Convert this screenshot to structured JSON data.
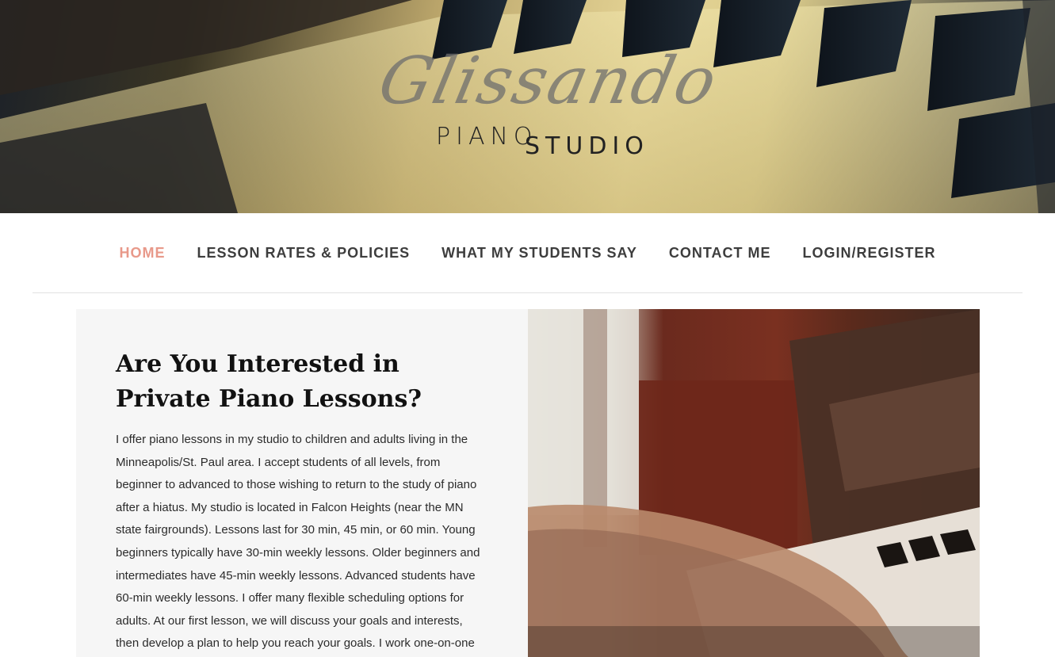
{
  "brand": {
    "script": "Glissando",
    "word1": "PIANO",
    "word2": "STUDIO"
  },
  "nav": {
    "items": [
      {
        "label": "HOME",
        "active": true
      },
      {
        "label": "LESSON RATES & POLICIES",
        "active": false
      },
      {
        "label": "WHAT MY STUDENTS SAY",
        "active": false
      },
      {
        "label": "CONTACT ME",
        "active": false
      },
      {
        "label": "LOGIN/REGISTER",
        "active": false
      }
    ],
    "active_color": "#e8998a"
  },
  "main": {
    "heading": "Are You Interested in Private Piano Lessons?",
    "body": "I offer piano lessons in my studio to children and adults living in the Minneapolis/St. Paul area. I accept students of all levels, from beginner to advanced to those wishing to return to the study of piano after a hiatus. My studio is located in Falcon Heights (near the MN state fairgrounds). Lessons last for 30 min, 45 min, or 60 min. Young beginners typically have 30-min weekly lessons. Older beginners and intermediates have 45-min weekly lessons. Advanced students have 60-min weekly lessons. I offer many flexible scheduling options for adults. At our first lesson, we will discuss your goals and interests, then develop a plan to help you reach your goals. I work one-on-one"
  },
  "images": {
    "hero": "piano-keys-banner",
    "photo": "hands-on-piano-keys"
  }
}
